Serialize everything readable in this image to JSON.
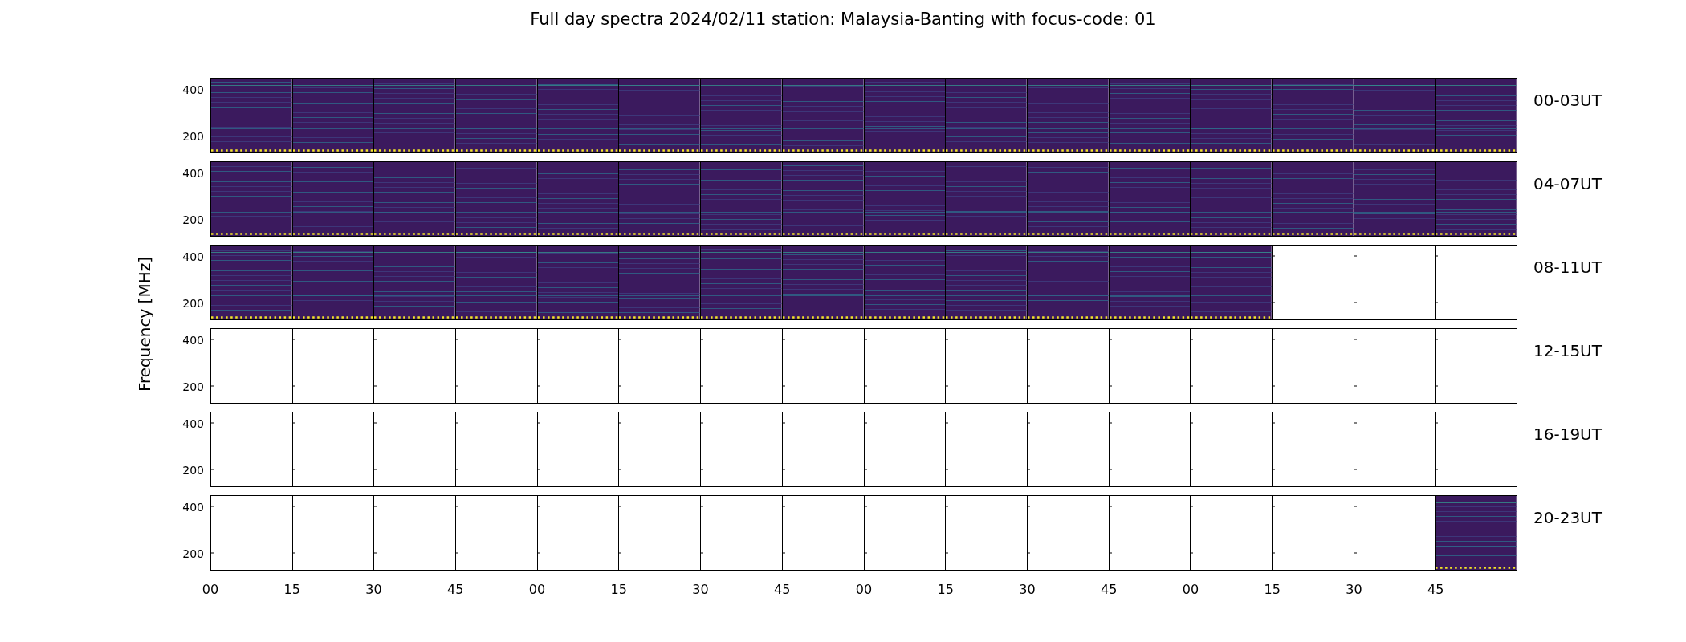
{
  "title": "Full day spectra 2024/02/11 station: Malaysia-Banting with focus-code: 01",
  "ylabel": "Frequency [MHz]",
  "rows": [
    {
      "label": "00-03UT",
      "yticks": [
        "400",
        "200"
      ],
      "panels": [
        {
          "has_data": true
        },
        {
          "has_data": true
        },
        {
          "has_data": true
        },
        {
          "has_data": true
        },
        {
          "has_data": true
        },
        {
          "has_data": true
        },
        {
          "has_data": true
        },
        {
          "has_data": true
        },
        {
          "has_data": true
        },
        {
          "has_data": true
        },
        {
          "has_data": true
        },
        {
          "has_data": true
        },
        {
          "has_data": true
        },
        {
          "has_data": true
        },
        {
          "has_data": true
        },
        {
          "has_data": true
        }
      ]
    },
    {
      "label": "04-07UT",
      "yticks": [
        "400",
        "200"
      ],
      "panels": [
        {
          "has_data": true
        },
        {
          "has_data": true
        },
        {
          "has_data": true
        },
        {
          "has_data": true
        },
        {
          "has_data": true
        },
        {
          "has_data": true
        },
        {
          "has_data": true
        },
        {
          "has_data": true
        },
        {
          "has_data": true
        },
        {
          "has_data": true
        },
        {
          "has_data": true
        },
        {
          "has_data": true
        },
        {
          "has_data": true
        },
        {
          "has_data": true
        },
        {
          "has_data": true
        },
        {
          "has_data": true
        }
      ]
    },
    {
      "label": "08-11UT",
      "yticks": [
        "400",
        "200"
      ],
      "panels": [
        {
          "has_data": true
        },
        {
          "has_data": true
        },
        {
          "has_data": true
        },
        {
          "has_data": true
        },
        {
          "has_data": true
        },
        {
          "has_data": true
        },
        {
          "has_data": true
        },
        {
          "has_data": true
        },
        {
          "has_data": true
        },
        {
          "has_data": true
        },
        {
          "has_data": true
        },
        {
          "has_data": true
        },
        {
          "has_data": true
        },
        {
          "has_data": false
        },
        {
          "has_data": false
        },
        {
          "has_data": false
        }
      ]
    },
    {
      "label": "12-15UT",
      "yticks": [
        "400",
        "200"
      ],
      "panels": [
        {
          "has_data": false
        },
        {
          "has_data": false
        },
        {
          "has_data": false
        },
        {
          "has_data": false
        },
        {
          "has_data": false
        },
        {
          "has_data": false
        },
        {
          "has_data": false
        },
        {
          "has_data": false
        },
        {
          "has_data": false
        },
        {
          "has_data": false
        },
        {
          "has_data": false
        },
        {
          "has_data": false
        },
        {
          "has_data": false
        },
        {
          "has_data": false
        },
        {
          "has_data": false
        },
        {
          "has_data": false
        }
      ]
    },
    {
      "label": "16-19UT",
      "yticks": [
        "400",
        "200"
      ],
      "panels": [
        {
          "has_data": false
        },
        {
          "has_data": false
        },
        {
          "has_data": false
        },
        {
          "has_data": false
        },
        {
          "has_data": false
        },
        {
          "has_data": false
        },
        {
          "has_data": false
        },
        {
          "has_data": false
        },
        {
          "has_data": false
        },
        {
          "has_data": false
        },
        {
          "has_data": false
        },
        {
          "has_data": false
        },
        {
          "has_data": false
        },
        {
          "has_data": false
        },
        {
          "has_data": false
        },
        {
          "has_data": false
        }
      ]
    },
    {
      "label": "20-23UT",
      "yticks": [
        "400",
        "200"
      ],
      "panels": [
        {
          "has_data": false
        },
        {
          "has_data": false
        },
        {
          "has_data": false
        },
        {
          "has_data": false
        },
        {
          "has_data": false
        },
        {
          "has_data": false
        },
        {
          "has_data": false
        },
        {
          "has_data": false
        },
        {
          "has_data": false
        },
        {
          "has_data": false
        },
        {
          "has_data": false
        },
        {
          "has_data": false
        },
        {
          "has_data": false
        },
        {
          "has_data": false
        },
        {
          "has_data": false
        },
        {
          "has_data": true
        }
      ]
    }
  ],
  "xticks": [
    "00",
    "15",
    "30",
    "45",
    "00",
    "15",
    "30",
    "45",
    "00",
    "15",
    "30",
    "45",
    "00",
    "15",
    "30",
    "45"
  ]
}
